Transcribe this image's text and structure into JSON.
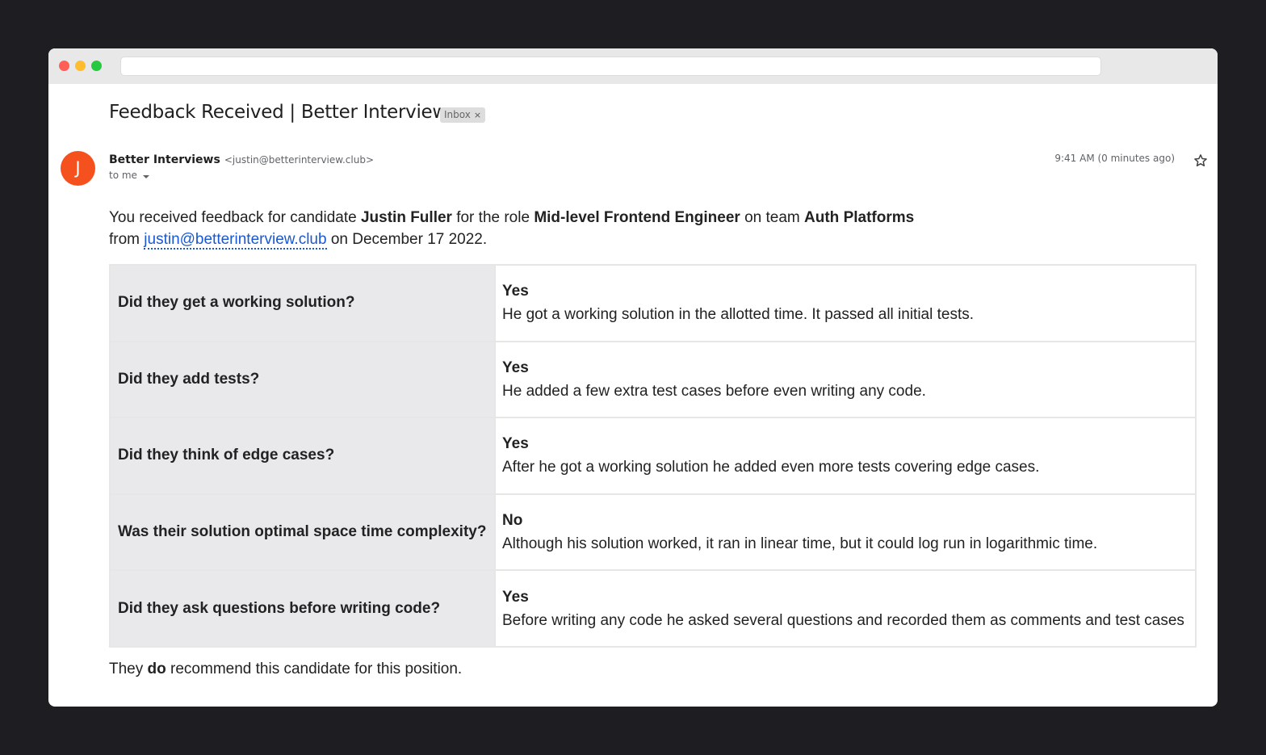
{
  "window": {
    "url": ""
  },
  "email": {
    "subject": "Feedback Received | Better Interviews",
    "label": "Inbox",
    "label_remove": "×",
    "avatar_letter": "J",
    "sender_name": "Better Interviews",
    "sender_email": "<justin@betterinterview.club>",
    "recipient": "to me",
    "timestamp": "9:41 AM (0 minutes ago)"
  },
  "intro": {
    "p1": "You received feedback for candidate ",
    "candidate": "Justin Fuller",
    "p2": " for the role ",
    "role": "Mid-level Frontend Engineer",
    "p3": " on team ",
    "team": "Auth Platforms",
    "p4": "from ",
    "reviewer_email": "justin@betterinterview.club",
    "p5": " on December 17 2022."
  },
  "feedback": [
    {
      "question": "Did they get a working solution?",
      "answer": "Yes",
      "detail": "He got a working solution in the allotted time. It passed all initial tests."
    },
    {
      "question": "Did they add tests?",
      "answer": "Yes",
      "detail": "He added a few extra test cases before even writing any code."
    },
    {
      "question": "Did they think of edge cases?",
      "answer": "Yes",
      "detail": "After he got a working solution he added even more tests covering edge cases."
    },
    {
      "question": "Was their solution optimal space time complexity?",
      "answer": "No",
      "detail": "Although his solution worked, it ran in linear time, but it could log run in logarithmic time."
    },
    {
      "question": "Did they ask questions before writing code?",
      "answer": "Yes",
      "detail": "Before writing any code he asked several questions and recorded them as comments and test cases"
    }
  ],
  "recommendation": {
    "p1": "They ",
    "verdict": "do",
    "p2": " recommend this candidate for this position."
  },
  "colors": {
    "avatar": "#f4511e",
    "link": "#1a58d0",
    "question_bg": "#e9e9ec"
  }
}
